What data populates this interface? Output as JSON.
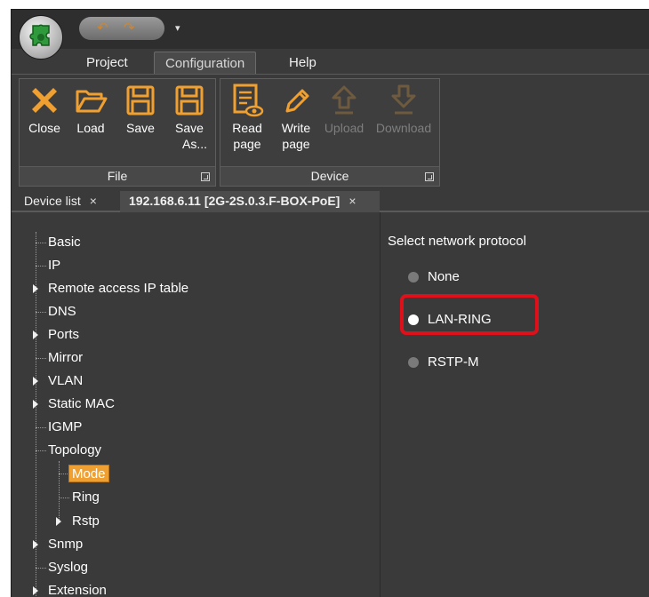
{
  "quick_access": {
    "undo_icon": "undo-icon",
    "redo_icon": "redo-icon",
    "more_label": "▾"
  },
  "menu": {
    "tabs": [
      {
        "label": "Project"
      },
      {
        "label": "Configuration"
      },
      {
        "label": "Help"
      }
    ],
    "active_tab": "Configuration"
  },
  "ribbon": {
    "groups": [
      {
        "label": "File",
        "buttons": [
          {
            "label_line1": "Close",
            "label_line2": "",
            "icon": "close-icon",
            "enabled": true
          },
          {
            "label_line1": "Load",
            "label_line2": "",
            "icon": "folder-open-icon",
            "enabled": true
          },
          {
            "label_line1": "Save",
            "label_line2": "",
            "icon": "save-icon",
            "enabled": true
          },
          {
            "label_line1": "Save",
            "label_line2": "As...",
            "icon": "save-as-icon",
            "enabled": true
          }
        ]
      },
      {
        "label": "Device",
        "buttons": [
          {
            "label_line1": "Read",
            "label_line2": "page",
            "icon": "read-page-icon",
            "enabled": true
          },
          {
            "label_line1": "Write",
            "label_line2": "page",
            "icon": "write-page-icon",
            "enabled": true
          },
          {
            "label_line1": "Upload",
            "label_line2": "",
            "icon": "upload-icon",
            "enabled": false
          },
          {
            "label_line1": "Download",
            "label_line2": "",
            "icon": "download-icon",
            "enabled": false
          }
        ]
      }
    ]
  },
  "doc_tabs": [
    {
      "label": "Device list",
      "close": "×",
      "active": false
    },
    {
      "label": "192.168.6.11 [2G-2S.0.3.F-BOX-PoE]",
      "close": "×",
      "active": true
    }
  ],
  "tree": {
    "items": [
      {
        "label": "Basic",
        "expandable": false
      },
      {
        "label": "IP",
        "expandable": false
      },
      {
        "label": "Remote access IP table",
        "expandable": true
      },
      {
        "label": "DNS",
        "expandable": false
      },
      {
        "label": "Ports",
        "expandable": true
      },
      {
        "label": "Mirror",
        "expandable": false
      },
      {
        "label": "VLAN",
        "expandable": true
      },
      {
        "label": "Static MAC",
        "expandable": true
      },
      {
        "label": "IGMP",
        "expandable": false
      },
      {
        "label": "Topology",
        "expandable": false,
        "expanded": true
      },
      {
        "label": "Mode",
        "expandable": false,
        "selected": true
      },
      {
        "label": "Ring",
        "expandable": false
      },
      {
        "label": "Rstp",
        "expandable": true
      },
      {
        "label": "Snmp",
        "expandable": true
      },
      {
        "label": "Syslog",
        "expandable": false
      },
      {
        "label": "Extension",
        "expandable": true
      }
    ]
  },
  "network_protocol": {
    "title": "Select network protocol",
    "options": [
      {
        "label": "None",
        "checked": false
      },
      {
        "label": "LAN-RING",
        "checked": true
      },
      {
        "label": "RSTP-M",
        "checked": false
      }
    ],
    "highlight_color": "#e0101b"
  },
  "colors": {
    "accent": "#f0a030",
    "background": "#3a3a3a"
  }
}
